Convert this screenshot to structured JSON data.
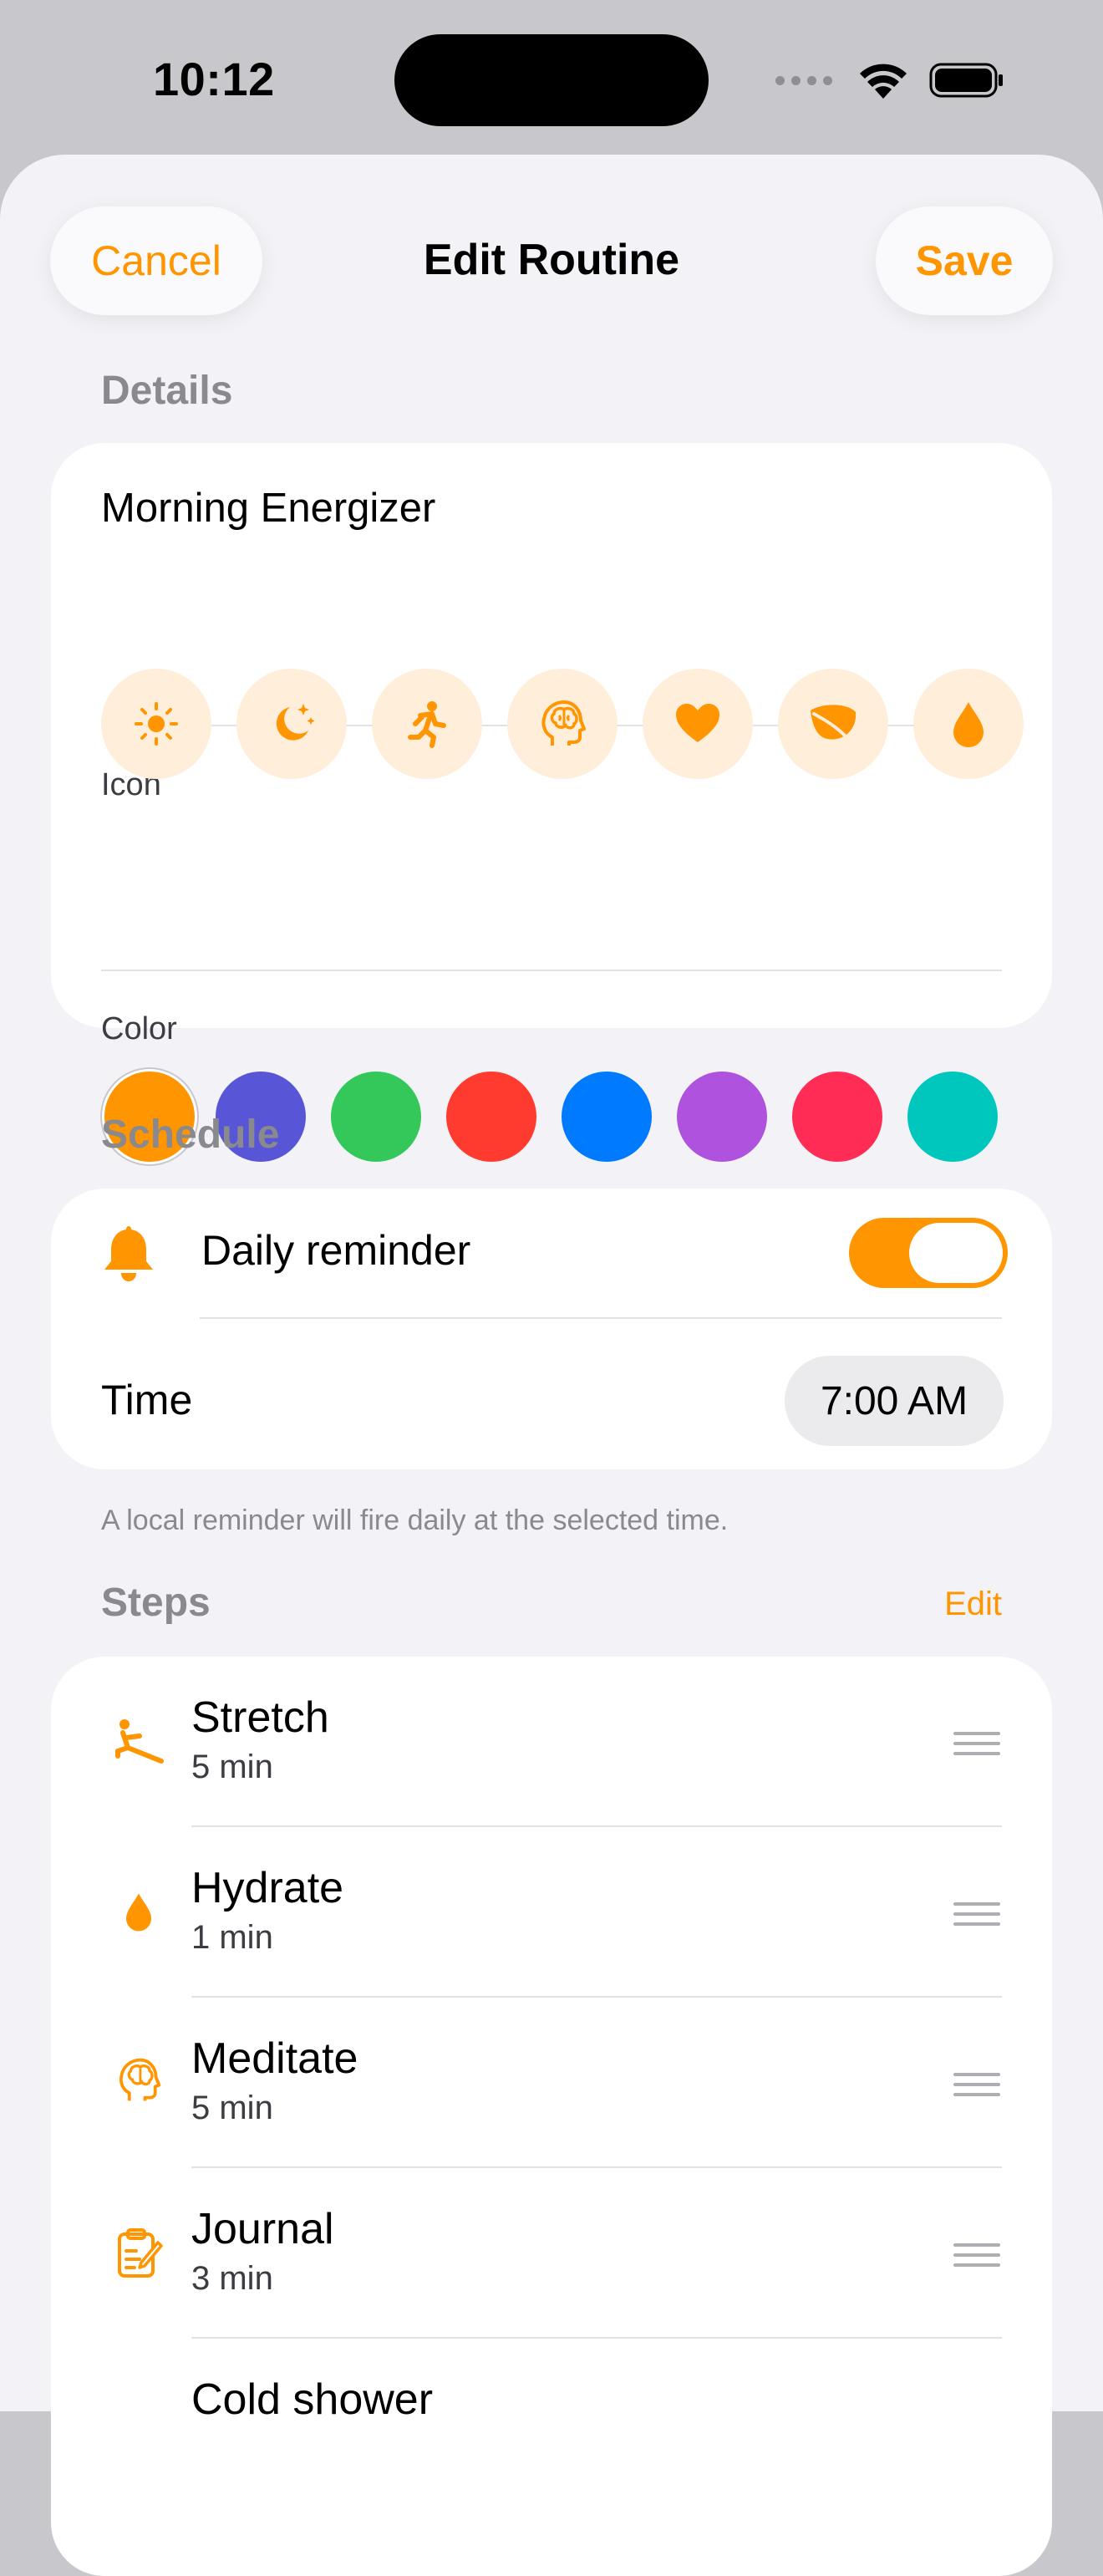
{
  "status_bar": {
    "time": "10:12"
  },
  "nav": {
    "cancel_label": "Cancel",
    "title": "Edit Routine",
    "save_label": "Save"
  },
  "details": {
    "header": "Details",
    "name_value": "Morning Energizer",
    "icon_label": "Icon",
    "icons": [
      "sun-icon",
      "moon-stars-icon",
      "runner-icon",
      "brain-head-icon",
      "heart-icon",
      "leaf-icon",
      "drop-icon"
    ],
    "color_label": "Color",
    "colors": [
      "#FF9500",
      "#5856D6",
      "#34C759",
      "#FF3B30",
      "#007AFF",
      "#AF52DE",
      "#FF2D55",
      "#00C7BE"
    ],
    "selected_color": "#FF9500"
  },
  "schedule": {
    "header": "Schedule",
    "reminder_label": "Daily reminder",
    "reminder_on": true,
    "time_label": "Time",
    "time_value": "7:00 AM",
    "footnote": "A local reminder will fire daily at the selected time."
  },
  "steps": {
    "header": "Steps",
    "edit_label": "Edit",
    "items": [
      {
        "title": "Stretch",
        "duration": "5 min",
        "icon": "stretch-icon"
      },
      {
        "title": "Hydrate",
        "duration": "1 min",
        "icon": "drop-icon"
      },
      {
        "title": "Meditate",
        "duration": "5 min",
        "icon": "brain-head-icon"
      },
      {
        "title": "Journal",
        "duration": "3 min",
        "icon": "clipboard-pen-icon"
      },
      {
        "title": "Cold shower",
        "duration": "",
        "icon": ""
      }
    ]
  },
  "accent_color": "#FF9500"
}
